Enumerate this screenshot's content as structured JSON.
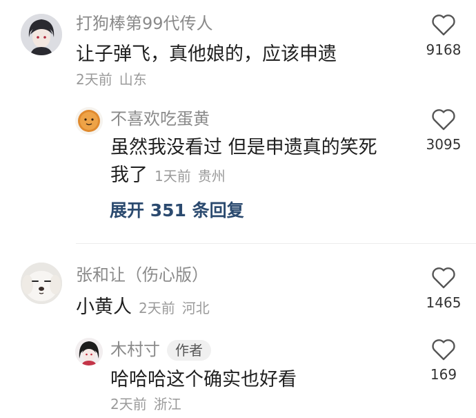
{
  "comments": [
    {
      "username": "打狗棒第99代传人",
      "text": "让子弹飞，真他娘的，应该申遗",
      "time": "2天前",
      "location": "山东",
      "likes": "9168",
      "avatar": "anime-boy-avatar",
      "replies": [
        {
          "username": "不喜欢吃蛋黄",
          "text_line1": "虽然我没看过 但是申遗真的笑死",
          "text_line2": "我了",
          "time": "1天前",
          "location": "贵州",
          "likes": "3095",
          "avatar": "egg-yolk-avatar"
        }
      ],
      "expand_label": "展开 351 条回复"
    },
    {
      "username": "张和让（伤心版）",
      "text": "小黄人",
      "time": "2天前",
      "location": "河北",
      "likes": "1465",
      "avatar": "puppy-avatar",
      "replies": [
        {
          "username": "木村寸",
          "badge": "作者",
          "text": "哈哈哈这个确实也好看",
          "time": "2天前",
          "location": "浙江",
          "likes": "169",
          "avatar": "anime-girl-avatar"
        }
      ]
    }
  ]
}
